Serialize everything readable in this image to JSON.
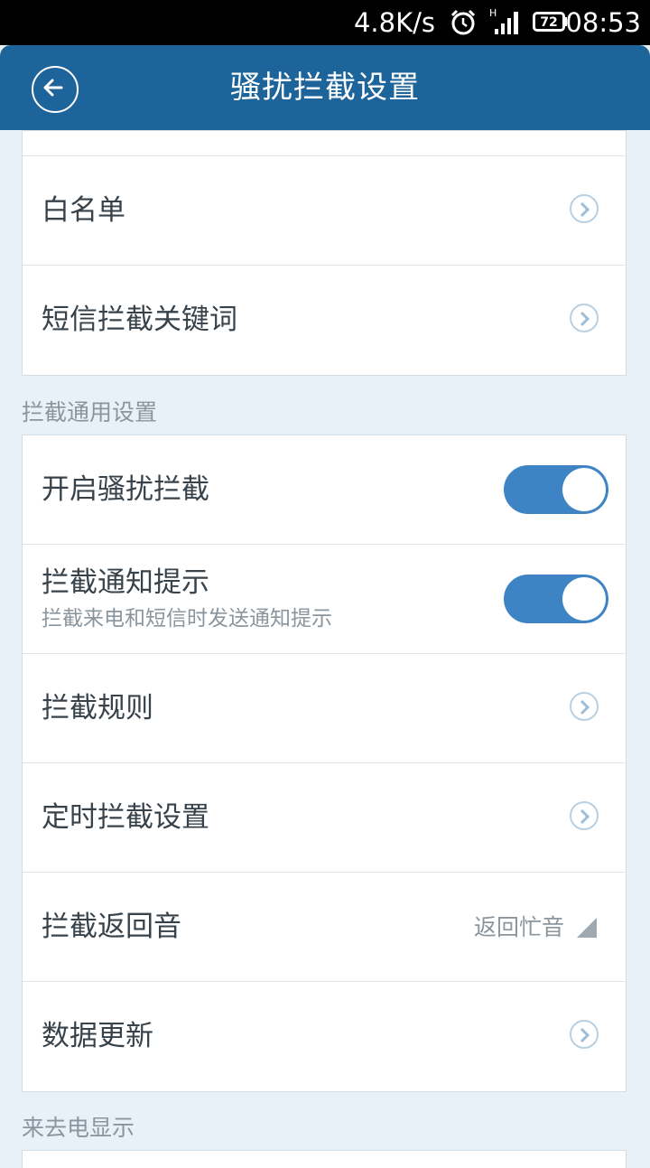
{
  "status_bar": {
    "net_speed": "4.8K/s",
    "network_type": "H",
    "battery": "72",
    "time": "08:53"
  },
  "header": {
    "title": "骚扰拦截设置",
    "back_icon": "back-arrow-icon"
  },
  "list_top": {
    "items": [
      {
        "label": "白名单"
      },
      {
        "label": "短信拦截关键词"
      }
    ]
  },
  "section_general": {
    "title": "拦截通用设置",
    "items": [
      {
        "label": "开启骚扰拦截",
        "toggle": true
      },
      {
        "label": "拦截通知提示",
        "sublabel": "拦截来电和短信时发送通知提示",
        "toggle": true
      },
      {
        "label": "拦截规则"
      },
      {
        "label": "定时拦截设置"
      },
      {
        "label": "拦截返回音",
        "value": "返回忙音"
      },
      {
        "label": "数据更新"
      }
    ]
  },
  "section_display": {
    "title": "来去电显示"
  },
  "colors": {
    "header_bg": "#1d649b",
    "toggle_on": "#3e84c4",
    "page_bg": "#e8f1f8"
  }
}
